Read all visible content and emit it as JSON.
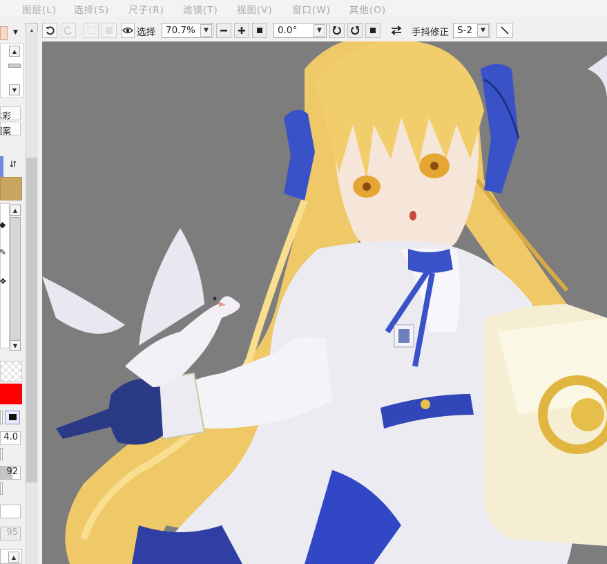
{
  "menu": {
    "layer": "图层(L)",
    "select": "选择(S)",
    "ruler": "尺子(R)",
    "filter": "滤镜(T)",
    "view": "视图(V)",
    "window": "窗口(W)",
    "other": "其他(O)"
  },
  "toolbar": {
    "select_label": "选择",
    "zoom_value": "70.7%",
    "rotation_value": "0.0°",
    "stabilizer_label": "手抖修正",
    "stabilizer_value": "S-2"
  },
  "left_panel": {
    "color_mode_label": "水彩",
    "pattern_label": "图案",
    "brush_size_value": "4.0",
    "density_value": "92",
    "grayed_value": "95"
  },
  "colors": {
    "canvas_bg": "#7d7d7d",
    "foreground": "#c8a763",
    "red_swatch": "#ff0000",
    "menu_text": "#a8a8a8"
  },
  "icons": [
    "undo-icon",
    "redo-icon",
    "eye-icon",
    "minus-icon",
    "plus-icon",
    "reset-icon",
    "rotate-left-icon",
    "rotate-right-icon",
    "flip-icon",
    "line-icon",
    "swap-icon",
    "pen-icon"
  ]
}
